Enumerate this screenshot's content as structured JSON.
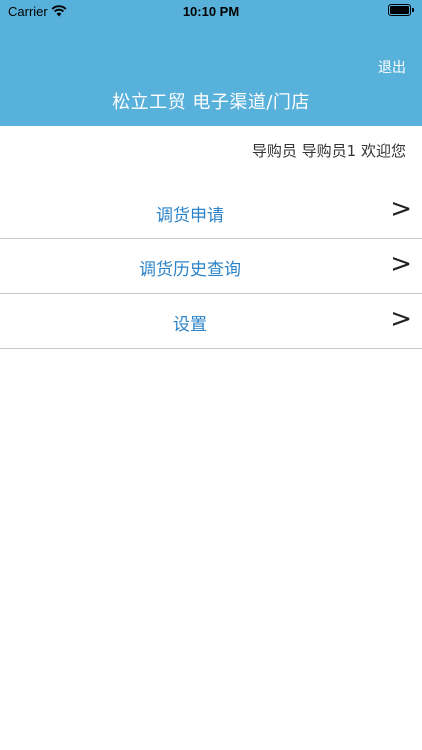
{
  "status_bar": {
    "carrier": "Carrier",
    "time": "10:10 PM",
    "icons": [
      "wifi-icon",
      "battery-icon"
    ]
  },
  "header": {
    "background_color": "#58b1da",
    "logout_label": "退出",
    "title": "松立工贸 电子渠道/门店"
  },
  "welcome_text": "导购员 导购员1 欢迎您",
  "menu": {
    "items": [
      {
        "label": "调货申请",
        "arrow": ">"
      },
      {
        "label": "调货历史查询",
        "arrow": ">"
      },
      {
        "label": "设置",
        "arrow": ">"
      }
    ]
  },
  "colors": {
    "accent_text": "#2b83c9"
  }
}
